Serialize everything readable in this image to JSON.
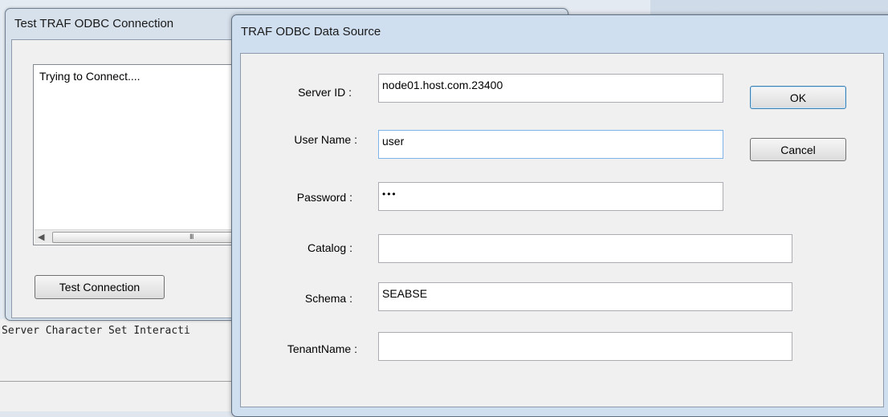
{
  "background": {
    "console_text": "Server Character Set Interacti"
  },
  "test_dialog": {
    "title": "Test TRAF ODBC Connection",
    "log_text": "Trying to Connect....",
    "test_button_label": "Test Connection"
  },
  "ds_dialog": {
    "title": "TRAF ODBC Data Source",
    "fields": {
      "server_id": {
        "label": "Server ID :",
        "value": "node01.host.com.23400"
      },
      "user_name": {
        "label": "User Name :",
        "value": "user"
      },
      "password": {
        "label": "Password :",
        "value": "•••"
      },
      "catalog": {
        "label": "Catalog :",
        "value": ""
      },
      "schema": {
        "label": "Schema :",
        "value": "SEABSE"
      },
      "tenant_name": {
        "label": "TenantName :",
        "value": ""
      }
    },
    "ok_label": "OK",
    "cancel_label": "Cancel"
  }
}
